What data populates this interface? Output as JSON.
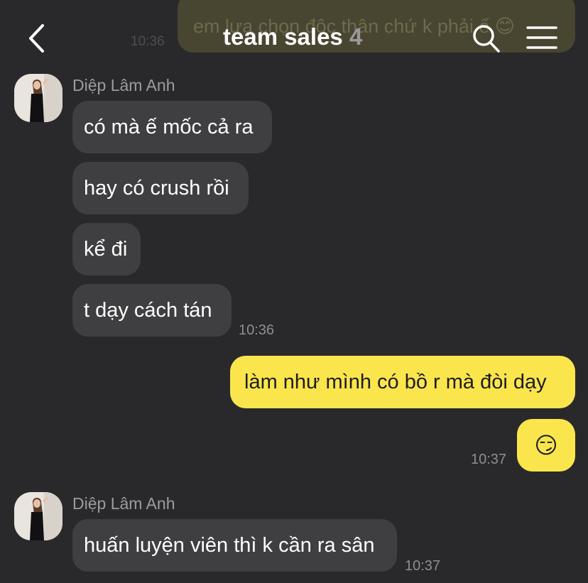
{
  "header": {
    "title": "team sales",
    "member_count": "4",
    "back_icon": "chevron-left-icon",
    "search_icon": "search-icon",
    "menu_icon": "hamburger-menu-icon"
  },
  "previous_message": {
    "text": "em lựa chọn độc thân chứ k phải ế 😊",
    "time": "10:36"
  },
  "messages": [
    {
      "sender": "Diệp Lâm Anh",
      "bubbles": [
        "có mà ế mốc cả ra",
        "hay có crush rồi",
        "kể đi",
        "t dạy cách tán"
      ],
      "time": "10:36"
    },
    {
      "sender": "me",
      "bubbles": [
        "làm như mình có bồ r mà đòi dạy",
        "😏"
      ],
      "time": "10:37"
    },
    {
      "sender": "Diệp Lâm Anh",
      "bubbles": [
        "huấn luyện viên thì k cần ra sân"
      ],
      "time": "10:37"
    }
  ],
  "colors": {
    "background": "#29292b",
    "incoming_bubble": "#3f3f41",
    "outgoing_bubble": "#fbe54d"
  }
}
